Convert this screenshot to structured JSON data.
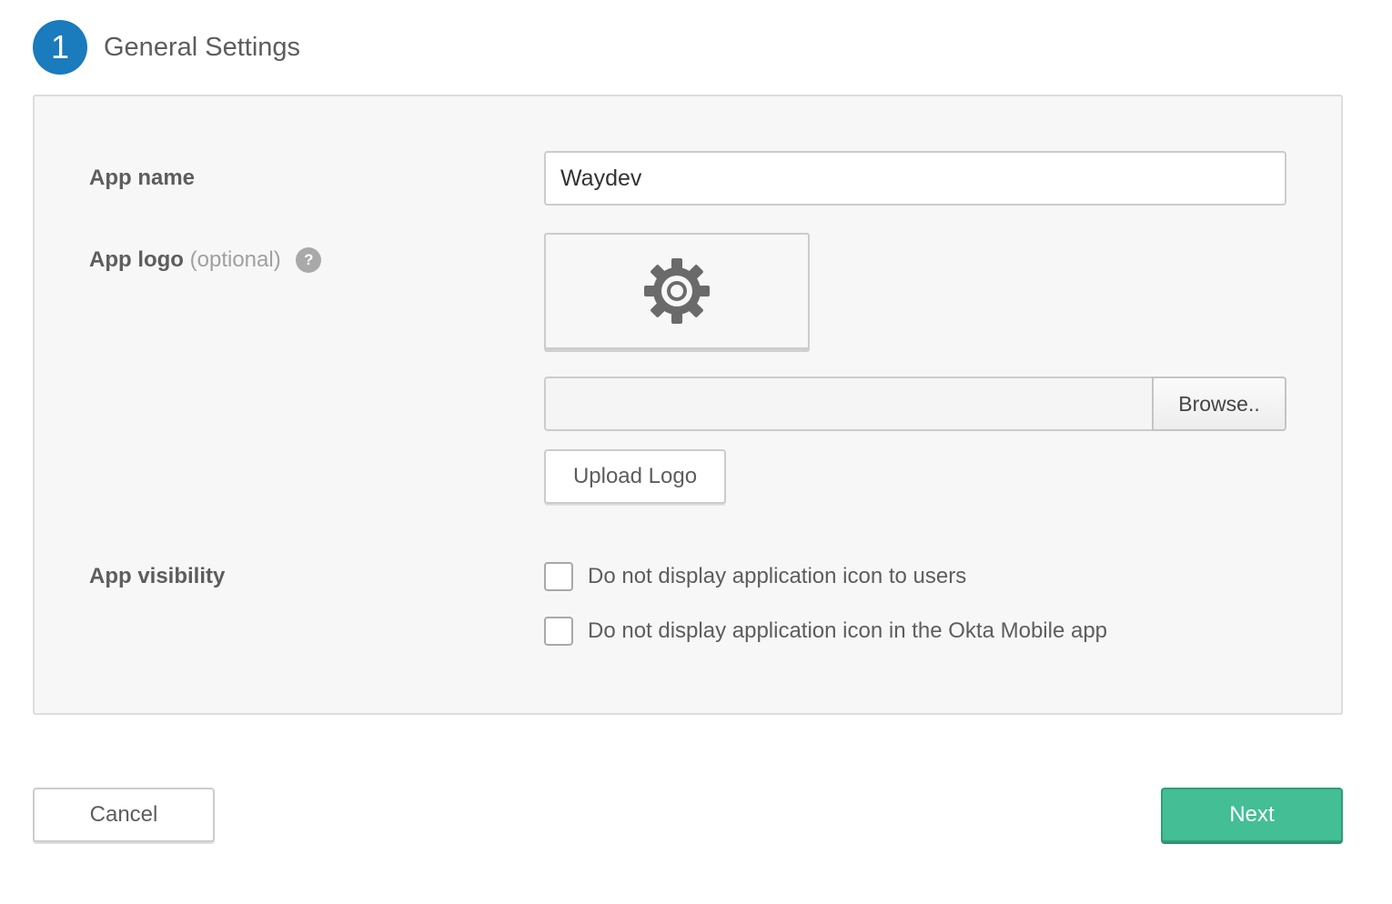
{
  "step": {
    "number": "1",
    "title": "General Settings"
  },
  "form": {
    "app_name": {
      "label": "App name",
      "value": "Waydev"
    },
    "app_logo": {
      "label": "App logo",
      "optional": "(optional)",
      "help": "?",
      "preview_icon": "gear-icon",
      "file_value": "",
      "browse_label": "Browse..",
      "upload_label": "Upload Logo"
    },
    "app_visibility": {
      "label": "App visibility",
      "options": [
        {
          "label": "Do not display application icon to users",
          "checked": false
        },
        {
          "label": "Do not display application icon in the Okta Mobile app",
          "checked": false
        }
      ]
    }
  },
  "actions": {
    "cancel_label": "Cancel",
    "next_label": "Next"
  },
  "colors": {
    "step_circle": "#1a7bbd",
    "next_button": "#43be95",
    "panel_background": "#f7f7f7"
  }
}
